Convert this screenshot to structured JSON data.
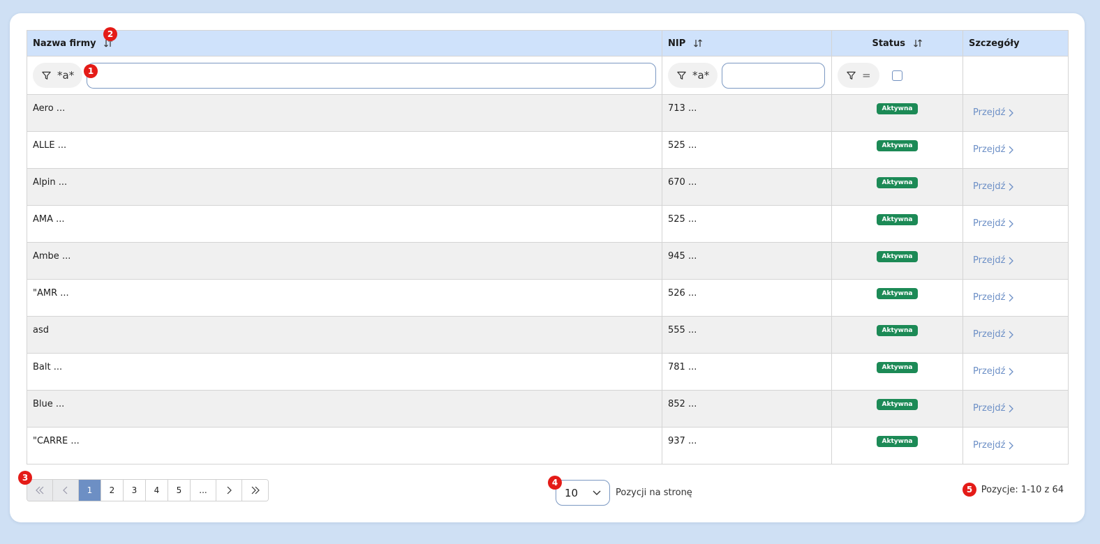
{
  "columns": {
    "name": "Nazwa firmy",
    "nip": "NIP",
    "status": "Status",
    "details": "Szczegóły"
  },
  "filters": {
    "name_mode": "*a*",
    "nip_mode": "*a*",
    "status_mode": "="
  },
  "rows": [
    {
      "name": "Aero ...",
      "nip": "713 ...",
      "status": "Aktywna",
      "link": "Przejdź"
    },
    {
      "name": "ALLE   ...",
      "nip": "525 ...",
      "status": "Aktywna",
      "link": "Przejdź"
    },
    {
      "name": "Alpin ...",
      "nip": "670 ...",
      "status": "Aktywna",
      "link": "Przejdź"
    },
    {
      "name": "AMA    ...",
      "nip": "525 ...",
      "status": "Aktywna",
      "link": "Przejdź"
    },
    {
      "name": "Ambe ...",
      "nip": "945 ...",
      "status": "Aktywna",
      "link": "Przejdź"
    },
    {
      "name": "\"AMR   ...",
      "nip": "526 ...",
      "status": "Aktywna",
      "link": "Przejdź"
    },
    {
      "name": "asd",
      "nip": "555 ...",
      "status": "Aktywna",
      "link": "Przejdź"
    },
    {
      "name": "Balt ...",
      "nip": "781 ...",
      "status": "Aktywna",
      "link": "Przejdź"
    },
    {
      "name": "Blue ...",
      "nip": "852 ...",
      "status": "Aktywna",
      "link": "Przejdź"
    },
    {
      "name": "\"CARRE   ...",
      "nip": "937 ...",
      "status": "Aktywna",
      "link": "Przejdź"
    }
  ],
  "pagination": {
    "pages": [
      "1",
      "2",
      "3",
      "4",
      "5"
    ],
    "ellipsis": "...",
    "current": "1"
  },
  "page_size": {
    "value": "10",
    "label": "Pozycji na stronę"
  },
  "count_text": "Pozycje: 1-10 z 64",
  "markers": [
    "1",
    "2",
    "3",
    "4",
    "5"
  ],
  "colors": {
    "page_bg": "#cfe0f4",
    "header_bg": "#cfe2fb",
    "badge_green": "#1c8a56",
    "link_blue": "#6c8fc6",
    "marker_red": "#e41b17"
  }
}
